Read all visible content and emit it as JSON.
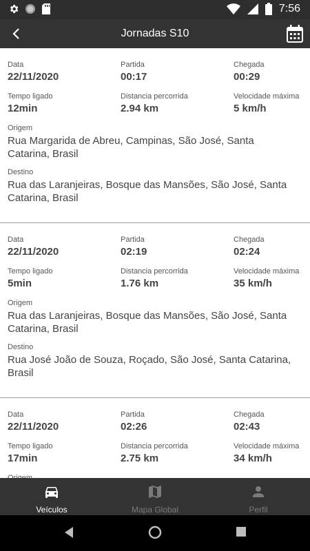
{
  "status_bar": {
    "time": "7:56",
    "icons": [
      "settings-icon",
      "circle-icon",
      "sd-card-icon",
      "wifi-icon",
      "signal-icon",
      "battery-icon"
    ]
  },
  "app_bar": {
    "title": "Jornadas S10",
    "icons": [
      "back-arrow-icon",
      "calendar-icon"
    ]
  },
  "labels": {
    "date": "Data",
    "departure": "Partida",
    "arrival": "Chegada",
    "time_on": "Tempo ligado",
    "distance": "Distancia percorrida",
    "max_speed": "Velocidade máxima",
    "origin": "Origem",
    "destination": "Destino"
  },
  "trips": [
    {
      "date": "22/11/2020",
      "departure": "00:17",
      "arrival": "00:29",
      "time_on": "12min",
      "distance": "2.94 km",
      "max_speed": "5 km/h",
      "origin": "Rua Margarida de Abreu, Campinas, São José, Santa Catarina, Brasil",
      "destination": "Rua das Laranjeiras, Bosque das Mansões, São José, Santa Catarina, Brasil"
    },
    {
      "date": "22/11/2020",
      "departure": "02:19",
      "arrival": "02:24",
      "time_on": "5min",
      "distance": "1.76 km",
      "max_speed": "35 km/h",
      "origin": "Rua das Laranjeiras, Bosque das Mansões, São José, Santa Catarina, Brasil",
      "destination": "Rua José João de Souza, Roçado, São José, Santa Catarina, Brasil"
    },
    {
      "date": "22/11/2020",
      "departure": "02:26",
      "arrival": "02:43",
      "time_on": "17min",
      "distance": "2.75 km",
      "max_speed": "34 km/h",
      "origin": "",
      "destination": ""
    }
  ],
  "bottom_nav": [
    {
      "label": "Veículos",
      "icon": "car-icon",
      "active": true
    },
    {
      "label": "Mapa Global",
      "icon": "map-icon",
      "active": false
    },
    {
      "label": "Perfil",
      "icon": "person-icon",
      "active": false
    }
  ],
  "colors": {
    "bar_background": "#333333",
    "divider": "#9e9e9e",
    "inactive_tab": "#7a7a7a"
  }
}
